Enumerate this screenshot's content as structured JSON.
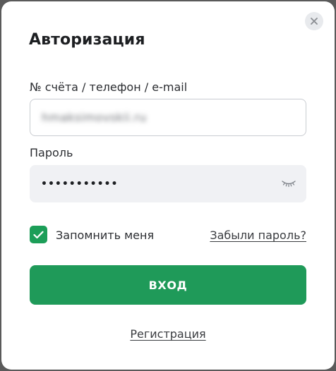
{
  "dialog": {
    "title": "Авторизация",
    "close_icon": "close-icon"
  },
  "login": {
    "label": "№ счёта / телефон / e-mail",
    "value": "hmaksimovskii.ru",
    "blurred": true
  },
  "password": {
    "label": "Пароль",
    "value": "•••••••••••",
    "eye_icon": "eye-closed-icon"
  },
  "remember": {
    "checked": true,
    "label": "Запомнить меня"
  },
  "forgot_link": "Забыли пароль?",
  "submit_label": "ВХОД",
  "register_link": "Регистрация",
  "colors": {
    "accent": "#1f9a59",
    "checkbox": "#1c9e58",
    "backdrop": "#5a5a5a"
  }
}
